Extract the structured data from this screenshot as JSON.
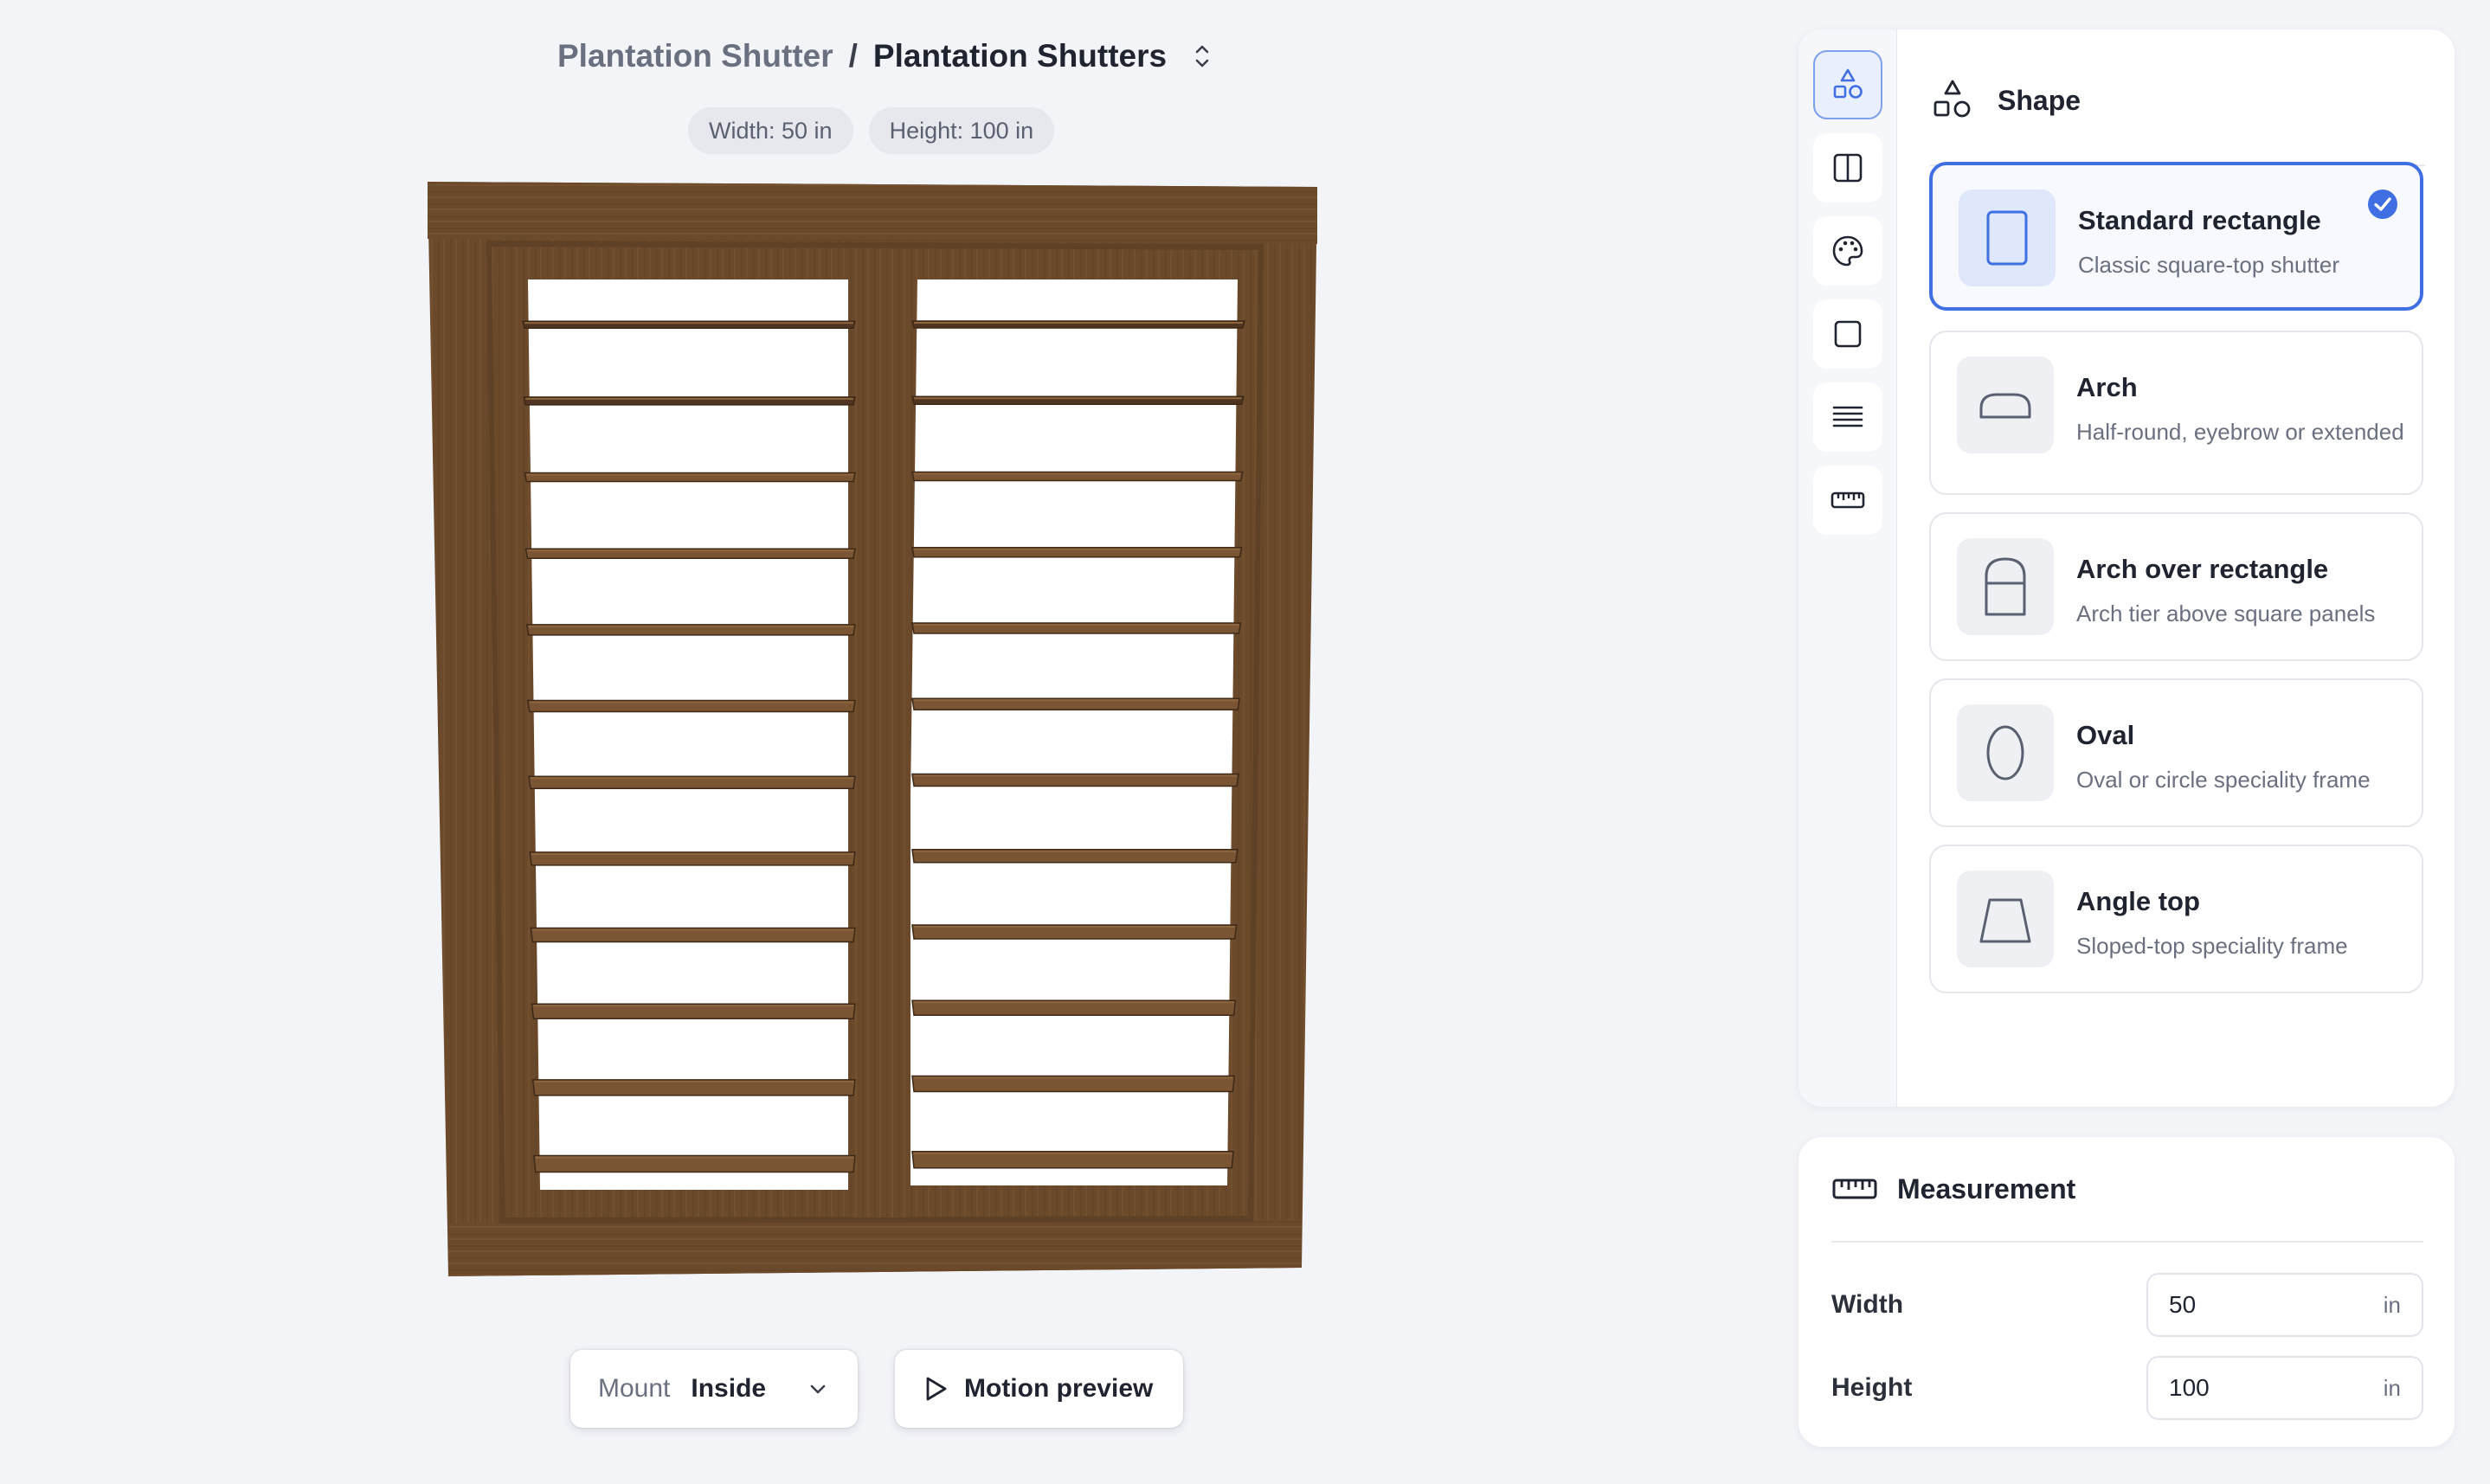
{
  "breadcrumb": {
    "parent": "Plantation Shutter",
    "separator": "/",
    "current": "Plantation Shutters"
  },
  "dimension_pills": {
    "width": "Width: 50 in",
    "height": "Height: 100 in"
  },
  "preview": {
    "material_color": "#6b4a2b",
    "panels": 2,
    "louvers_per_panel": 12
  },
  "controls": {
    "mount_label": "Mount",
    "mount_value": "Inside",
    "motion_preview": "Motion preview"
  },
  "sidebar": {
    "tools": [
      {
        "icon": "shapes-icon",
        "active": true
      },
      {
        "icon": "panels-icon",
        "active": false
      },
      {
        "icon": "palette-icon",
        "active": false
      },
      {
        "icon": "frame-icon",
        "active": false
      },
      {
        "icon": "louvers-icon",
        "active": false
      },
      {
        "icon": "ruler-icon",
        "active": false
      }
    ]
  },
  "shape_panel": {
    "title": "Shape",
    "options": [
      {
        "name": "Standard rectangle",
        "description": "Classic square-top shutter",
        "selected": true
      },
      {
        "name": "Arch",
        "description": "Half-round, eyebrow or extended",
        "selected": false
      },
      {
        "name": "Arch over rectangle",
        "description": "Arch tier above square panels",
        "selected": false
      },
      {
        "name": "Oval",
        "description": "Oval or circle speciality frame",
        "selected": false
      },
      {
        "name": "Angle top",
        "description": "Sloped-top speciality frame",
        "selected": false
      }
    ]
  },
  "measurement": {
    "title": "Measurement",
    "width_label": "Width",
    "width_value": "50",
    "width_unit": "in",
    "height_label": "Height",
    "height_value": "100",
    "height_unit": "in"
  },
  "colors": {
    "accent": "#3f6fe3",
    "background": "#f3f4f8",
    "wood": "#6b4a2b"
  }
}
